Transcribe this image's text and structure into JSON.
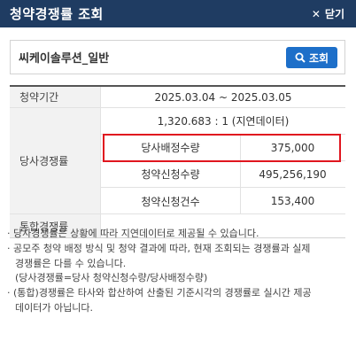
{
  "header": {
    "title": "청약경쟁률 조회",
    "close_label": "닫기"
  },
  "search": {
    "name": "씨케이솔루션_일반",
    "button_label": "조회"
  },
  "table": {
    "period_label": "청약기간",
    "period_value": "2025.03.04 ~ 2025.03.05",
    "company_label": "당사경쟁률",
    "ratio_value": "1,320.683 : 1 (지연데이터)",
    "sub_rows": [
      {
        "label": "당사배정수량",
        "value": "375,000"
      },
      {
        "label": "청약신청수량",
        "value": "495,256,190"
      },
      {
        "label": "청약신청건수",
        "value": "153,400"
      }
    ],
    "total_label": "통합경쟁률",
    "total_value": ""
  },
  "notes": [
    "· 당사경쟁률은 상황에 따라 지연데이터로 제공될 수 있습니다.",
    "· 공모주 청약 배정 방식 및 청약 결과에 따라, 현재 조회되는 경쟁률과 실제",
    "  경쟁률은 다를 수 있습니다.",
    "  (당사경쟁률=당사 청약신청수량/당사배정수량)",
    "· (통합)경쟁률은 타사와 합산하여 산출된 기준시각의 경쟁률로 실시간 제공",
    "  데이터가 아닙니다."
  ]
}
